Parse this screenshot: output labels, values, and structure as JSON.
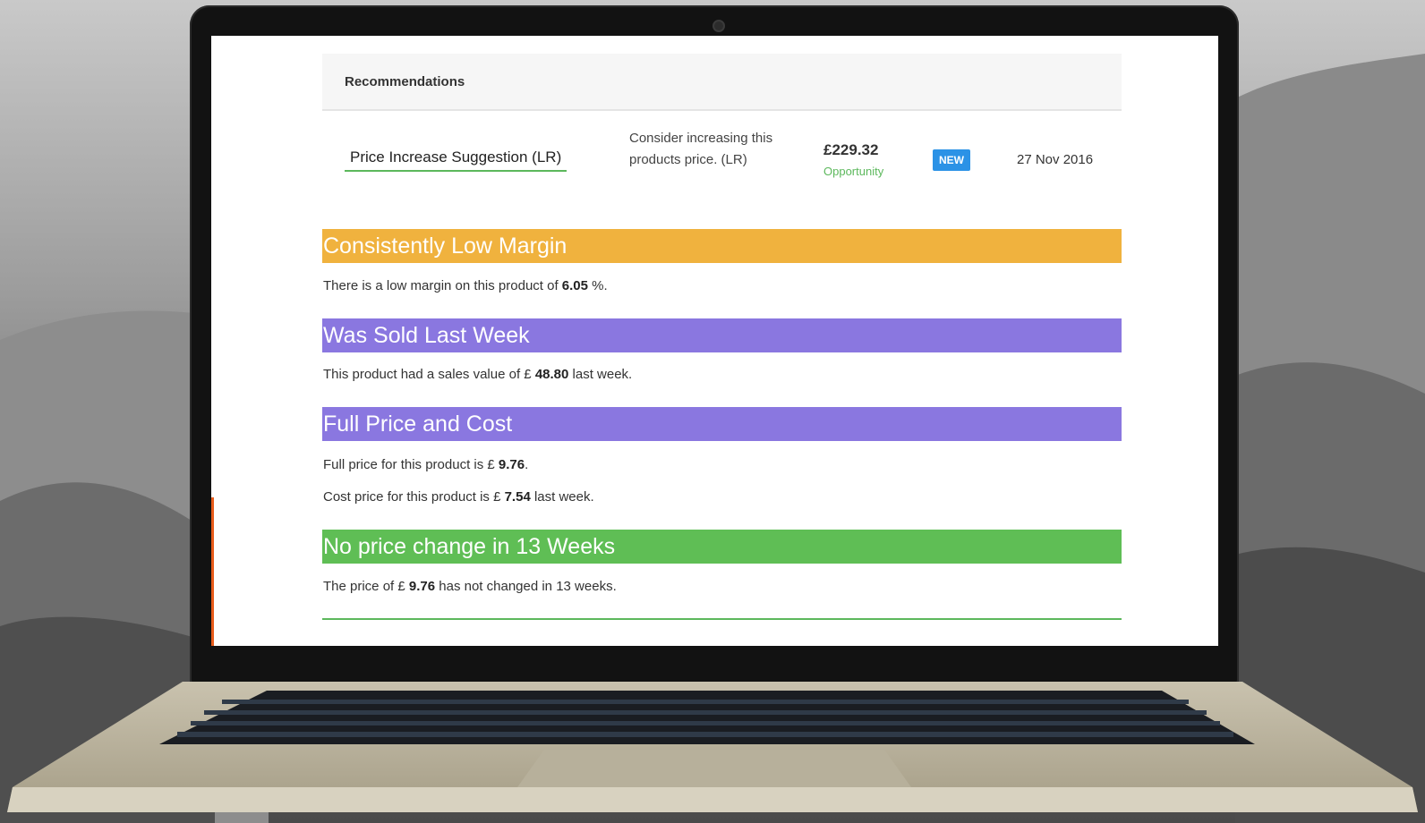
{
  "colors": {
    "orange": "#f0b23e",
    "purple": "#8a77e0",
    "green": "#5fbe55",
    "badge_blue": "#2b92e6",
    "link_underline": "#5cb85c"
  },
  "recommendations": {
    "header": "Recommendations",
    "row": {
      "link": "Price Increase Suggestion (LR)",
      "description": "Consider increasing this products price. (LR)",
      "price": "£229.32",
      "opportunity": "Opportunity",
      "badge": "NEW",
      "date": "27 Nov 2016"
    }
  },
  "sections": {
    "low_margin": {
      "title": "Consistently Low Margin",
      "text_before": "There is a low margin on this product of ",
      "value": "6.05",
      "text_after": " %."
    },
    "sold_last_week": {
      "title": "Was Sold Last Week",
      "text_before": "This product had a sales value of £ ",
      "value": "48.80",
      "text_after": " last week."
    },
    "full_price_cost": {
      "title": "Full Price and Cost",
      "line1_before": "Full price for this product is £ ",
      "line1_value": "9.76",
      "line1_after": ".",
      "line2_before": "Cost price for this product is £ ",
      "line2_value": "7.54",
      "line2_after": " last week."
    },
    "no_price_change": {
      "title": "No price change in 13 Weeks",
      "text_before": "The price of £ ",
      "value": "9.76",
      "text_after": " has not changed in 13 weeks."
    }
  }
}
